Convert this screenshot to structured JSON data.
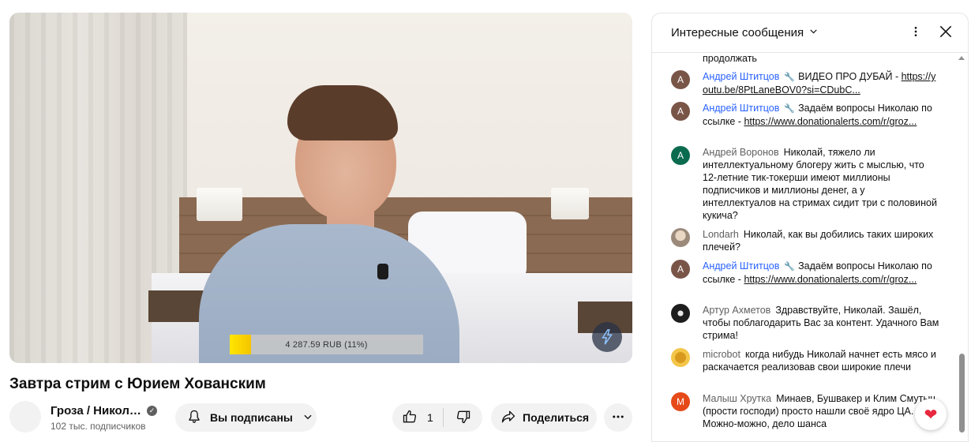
{
  "video": {
    "goal_text": "4 287.59 RUB (11%)",
    "goal_progress": 0.11,
    "title": "Завтра стрим с Юрием Хованским"
  },
  "channel": {
    "name": "Гроза / Никол…",
    "subscribers": "102 тыс. подписчиков"
  },
  "actions": {
    "subscribed_label": "Вы подписаны",
    "like_count": "1",
    "share_label": "Поделиться"
  },
  "chat": {
    "mode_label": "Интересные сообщения",
    "partial_top": "продолжать",
    "messages": [
      {
        "avatar": "А",
        "author": "Андрей Штитцов",
        "member": true,
        "text": "ВИДЕО ПРО ДУБАЙ - ",
        "link": "https://youtu.be/8PtLaneBOV0?si=CDubC..."
      },
      {
        "avatar": "А",
        "author": "Андрей Штитцов",
        "member": true,
        "text": "Задаём вопросы Николаю по ссылке - ",
        "link": "https://www.donationalerts.com/r/groz..."
      },
      {
        "avatar": "А",
        "author": "Андрей Воронов",
        "member": false,
        "text": "Николай, тяжело ли интеллектуальному блогеру жить с мыслью, что 12-летние тик-токерши имеют миллионы подписчиков и миллионы денег, а у интеллектуалов на стримах сидит три с половиной кукича?",
        "link": ""
      },
      {
        "avatar": "",
        "author": "Londarh",
        "member": false,
        "text": "Николай, как вы добились таких широких плечей?",
        "link": ""
      },
      {
        "avatar": "А",
        "author": "Андрей Штитцов",
        "member": true,
        "text": "Задаём вопросы Николаю по ссылке - ",
        "link": "https://www.donationalerts.com/r/groz..."
      },
      {
        "avatar": "",
        "author": "Артур Ахметов",
        "member": false,
        "text": "Здравствуйте, Николай. Зашёл, чтобы поблагодарить Вас за контент. Удачного Вам стрима!",
        "link": ""
      },
      {
        "avatar": "",
        "author": "microbot",
        "member": false,
        "text": "когда нибудь Николай начнет есть мясо и раскачается реализовав свои широкие плечи",
        "link": ""
      },
      {
        "avatar": "М",
        "author": "Малыш Хрутка",
        "member": false,
        "text": "Минаев, Бушвакер и Клим Смутыч (прости господи) просто нашли своё ядро ЦА. Можно-можно, дело шанса",
        "link": ""
      }
    ]
  },
  "colors": {
    "avatar_brown": "#795548",
    "avatar_green": "#0b6b4f",
    "avatar_orange": "#e64a19",
    "member_blue": "#2962ff",
    "goal_yellow": "#ffe600"
  }
}
